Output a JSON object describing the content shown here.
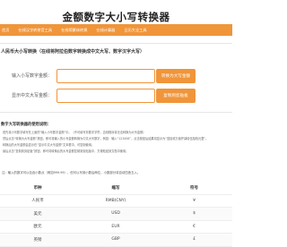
{
  "header": {
    "title": "金额数字大小写转换器"
  },
  "nav": {
    "items": [
      "首页",
      "在线汉字转拼音工具",
      "在线简繁体转换",
      "在线计算器",
      "日历大全工具"
    ]
  },
  "converter": {
    "title": "人民币大小写转换（在线将阿拉伯数字转换成中文大写、数字汉字大写）",
    "input_label": "输入小写数字金额：",
    "input_value": "",
    "input_placeholder": "",
    "convert_button": "转换为大写金额",
    "output_label": "显示中文大写金额：",
    "output_value": "",
    "copy_button": "复制到剪贴板"
  },
  "instructions": {
    "title": "数字大写转换器的使用说明：",
    "lines": [
      "首先将小写数字填写在上面的“输入小写数字金额”中。（不可填写非数字字符，否则程序将无法转换为大写金额）",
      "然后点击“转换为大写金额”按钮，即可将输入的小写金额转换为中文大写数字，例如：输入“123456”，点击按钮后结果将显示为“壹拾贰万叁仟肆佰伍拾陆元整”。",
      "转换后的大写金额会显示在“显示中文大写金额”文本框中，可复制使用。",
      "最后点击“复制到剪贴板”按钮，即可将转换后的大写金额复制到剪贴板中，方便粘贴到文档中使用。"
    ]
  },
  "note": "注：输入的数字可以包含小数点（例如999.99），但可以写到小数后两位，小数部分将自动四舍五入。",
  "currency_table": {
    "headers": [
      "币种",
      "缩写",
      "符号"
    ],
    "rows": [
      [
        "人民币",
        "RMB(CNY)",
        "¥"
      ],
      [
        "美元",
        "USD",
        "$"
      ],
      [
        "欧元",
        "EUR",
        "€"
      ],
      [
        "英镑",
        "GBP",
        "£"
      ]
    ]
  }
}
